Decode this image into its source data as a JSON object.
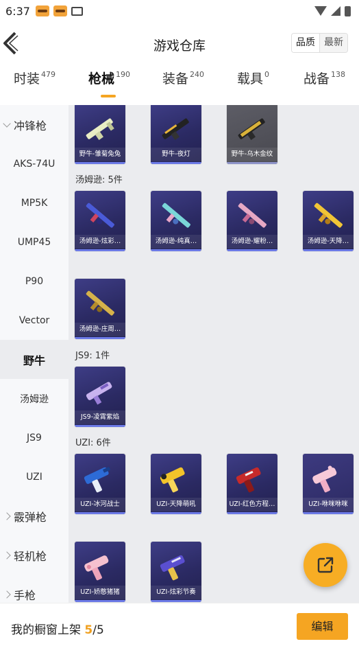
{
  "status_bar": {
    "time": "6:37"
  },
  "header": {
    "title": "游戏仓库",
    "sort": {
      "quality": "品质",
      "newest": "最新"
    }
  },
  "tabs": [
    {
      "label": "时装",
      "count": "479"
    },
    {
      "label": "枪械",
      "count": "190"
    },
    {
      "label": "装备",
      "count": "240"
    },
    {
      "label": "载具",
      "count": "0"
    },
    {
      "label": "战备",
      "count": "138"
    }
  ],
  "sidebar": {
    "category_smg": "冲锋枪",
    "items": [
      "AKS-74U",
      "MP5K",
      "UMP45",
      "P90",
      "Vector",
      "野牛",
      "汤姆逊",
      "JS9",
      "UZI"
    ],
    "category_shotgun": "霰弹枪",
    "category_lmg": "轻机枪",
    "category_pistol": "手枪"
  },
  "sections": {
    "thompson": "汤姆逊: 5件",
    "js9": "JS9: 1件",
    "uzi": "UZI: 6件"
  },
  "cards": {
    "bizon": [
      "野牛-雏菊兔兔",
      "野牛-夜灯",
      "野牛-乌木金纹"
    ],
    "thompson": [
      "汤姆逊-炫彩…",
      "汤姆逊-纯真…",
      "汤姆逊-耀粉…",
      "汤姆逊-天降…",
      "汤姆逊-庄周…"
    ],
    "js9": [
      "JS9-凌霄紫焰"
    ],
    "uzi": [
      "UZI-冰河战士",
      "UZI-天降萌吼",
      "UZI-红色方程…",
      "UZI-咻咪咻咪",
      "UZI-娇憨猪猪",
      "UZI-炫彩节奏"
    ]
  },
  "footer": {
    "label": "我的橱窗上架 ",
    "shown": "5",
    "total": "/5",
    "edit": "编辑"
  },
  "colors": {
    "accent": "#f5a522",
    "card_bg": "#2b2a63",
    "content_bg": "#ebecef"
  }
}
